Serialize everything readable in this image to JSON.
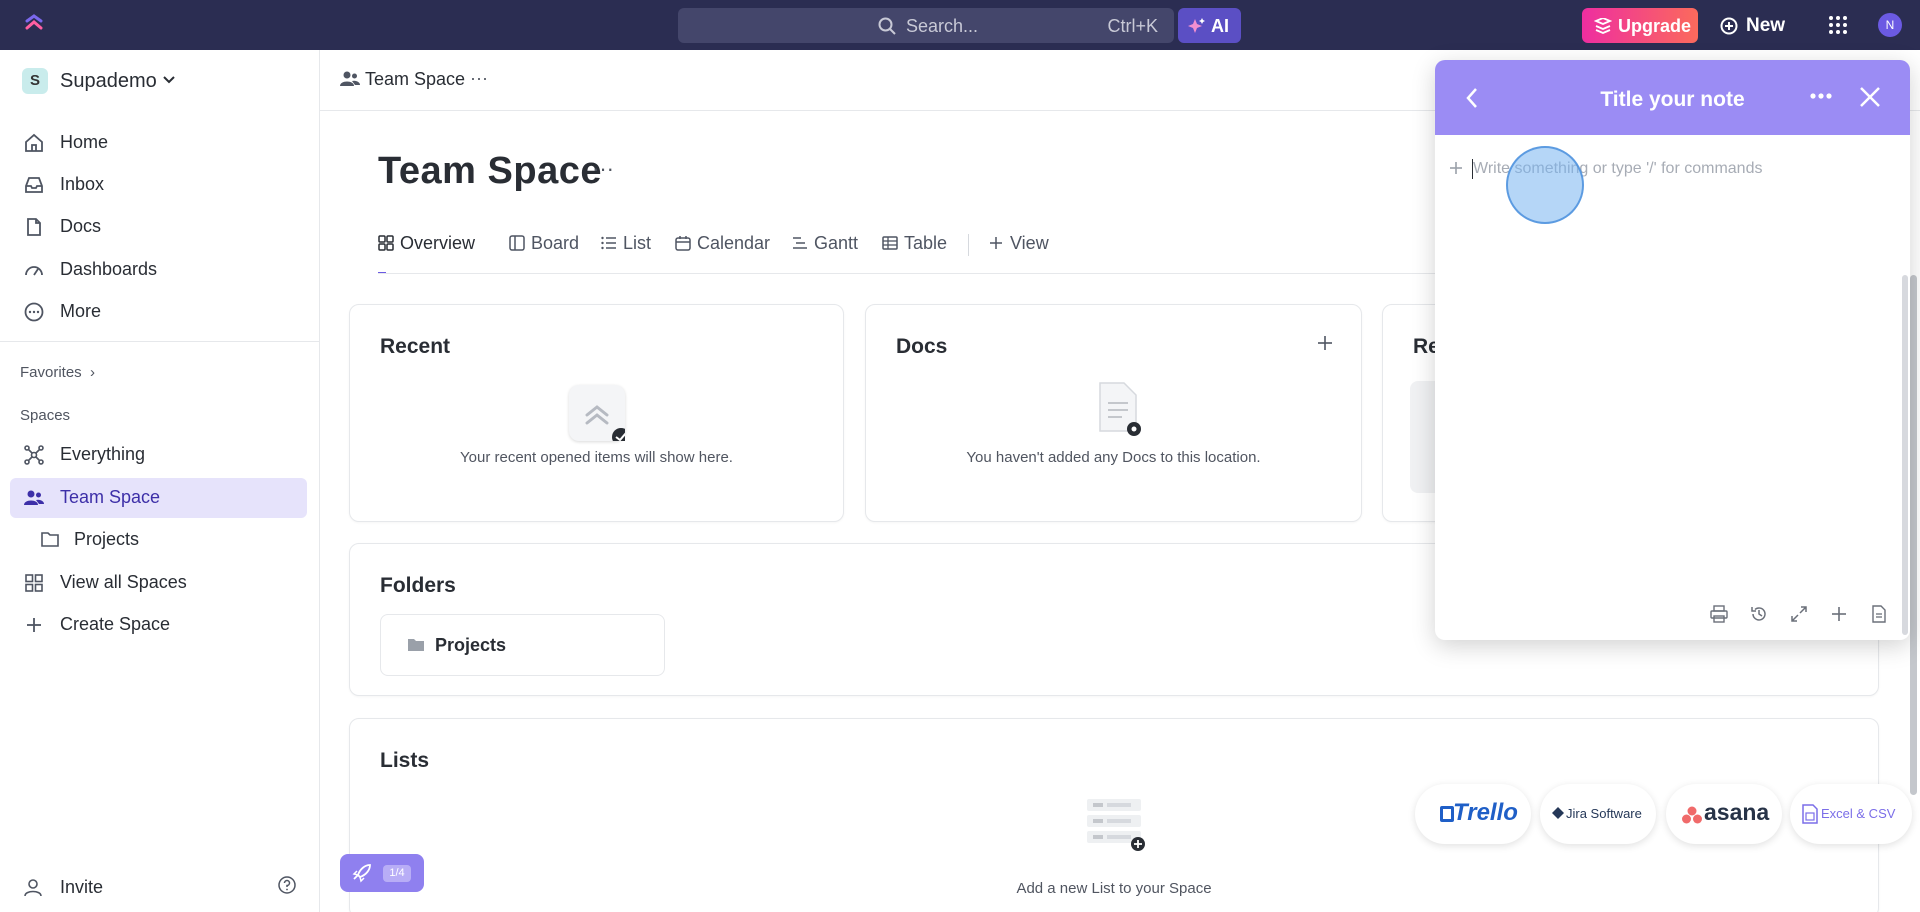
{
  "topbar": {
    "search_placeholder": "Search...",
    "search_shortcut": "Ctrl+K",
    "ai_label": "AI",
    "upgrade_label": "Upgrade",
    "new_label": "New",
    "avatar_initial": "N"
  },
  "sidebar": {
    "workspace": {
      "initial": "S",
      "name": "Supademo"
    },
    "items": [
      {
        "label": "Home",
        "icon": "home-icon"
      },
      {
        "label": "Inbox",
        "icon": "inbox-icon"
      },
      {
        "label": "Docs",
        "icon": "docs-icon"
      },
      {
        "label": "Dashboards",
        "icon": "dashboard-icon"
      },
      {
        "label": "More",
        "icon": "more-icon"
      }
    ],
    "favorites_label": "Favorites",
    "spaces_label": "Spaces",
    "spaces": [
      {
        "label": "Everything",
        "icon": "everything-icon"
      },
      {
        "label": "Team Space",
        "icon": "team-icon",
        "active": true
      },
      {
        "label": "Projects",
        "icon": "folder-icon"
      },
      {
        "label": "View all Spaces",
        "icon": "grid-icon"
      },
      {
        "label": "Create Space",
        "icon": "plus-icon"
      }
    ],
    "invite_label": "Invite"
  },
  "main": {
    "breadcrumb": "Team Space",
    "breadcrumb_more": "···",
    "title": "Team Space",
    "title_more": "···",
    "tabs": [
      {
        "label": "Overview",
        "active": true
      },
      {
        "label": "Board"
      },
      {
        "label": "List"
      },
      {
        "label": "Calendar"
      },
      {
        "label": "Gantt"
      },
      {
        "label": "Table"
      },
      {
        "label": "View"
      }
    ],
    "cards": {
      "recent": {
        "title": "Recent",
        "empty": "Your recent opened items will show here."
      },
      "docs": {
        "title": "Docs",
        "empty": "You haven't added any Docs to this location."
      },
      "third": {
        "title": "Re"
      },
      "folders": {
        "title": "Folders",
        "items": [
          "Projects"
        ]
      },
      "lists": {
        "title": "Lists",
        "empty": "Add a new List to your Space"
      }
    }
  },
  "note": {
    "title": "Title your note",
    "placeholder": "Write something or type '/' for commands"
  },
  "importers": {
    "trello": "Trello",
    "jira": "Jira Software",
    "asana": "asana",
    "excel": "Excel & CSV"
  },
  "onboarding": {
    "progress": "1/4"
  },
  "colors": {
    "topbar": "#2b2d52",
    "accent": "#6b5ae3",
    "note_header": "#9b8cf4",
    "active_nav": "#e6e3fb"
  }
}
